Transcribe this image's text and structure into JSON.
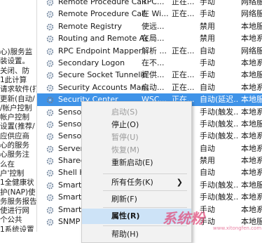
{
  "description_pane": [
    "心)服务监",
    "装设置。",
    "关闭、防",
    "1此计算",
    "请求软件(打",
    "更新(自动/",
    "/帐户控制",
    "帐户控制",
    "设置(推荐/",
    "应供应商",
    "心的服务",
    "心服务注",
    "么在",
    "户'控制",
    "1全健康状",
    "护(NAP)使",
    "务服务报告",
    "使进行网",
    "个公共",
    "1系统设置"
  ],
  "services": [
    {
      "name": "Remote Procedure Call ...",
      "desc": "RPC...",
      "state": "正在...",
      "startup": "手动",
      "logon": "网络服"
    },
    {
      "name": "Remote Procedure Call (...",
      "desc": "在 Wi...",
      "state": "正在...",
      "startup": "手动",
      "logon": "网络服"
    },
    {
      "name": "Remote Registry",
      "desc": "使远...",
      "state": "",
      "startup": "禁用",
      "logon": "本地服"
    },
    {
      "name": "Routing and Remote Acc...",
      "desc": "在局...",
      "state": "",
      "startup": "禁用",
      "logon": "本地系"
    },
    {
      "name": "RPC Endpoint Mapper",
      "desc": "解析 ...",
      "state": "正在...",
      "startup": "自动",
      "logon": "网络服"
    },
    {
      "name": "Secondary Logon",
      "desc": "在不...",
      "state": "",
      "startup": "手动",
      "logon": "本地系"
    },
    {
      "name": "Secure Socket Tunneling ...",
      "desc": "提供...",
      "state": "正在...",
      "startup": "手动",
      "logon": "本地服"
    },
    {
      "name": "Security Accounts Manag...",
      "desc": "启动...",
      "state": "正在...",
      "startup": "自动",
      "logon": "本地系"
    },
    {
      "name": "Security Center",
      "desc": "WSC...",
      "state": "正在...",
      "startup": "自动(延迟...",
      "logon": "本地服"
    },
    {
      "name": "Sensor Data",
      "desc": "",
      "state": "",
      "startup": "手动(触发...",
      "logon": "本地系"
    },
    {
      "name": "Sensor Moni",
      "desc": "",
      "state": "",
      "startup": "手动(触发...",
      "logon": "本地服"
    },
    {
      "name": "Sensor Servi",
      "desc": "",
      "state": "",
      "startup": "手动(触发...",
      "logon": "本地系"
    },
    {
      "name": "Server",
      "desc": "",
      "state": "",
      "startup": "自动",
      "logon": "本地系"
    },
    {
      "name": "Shared PC Ac",
      "desc": "",
      "state": "",
      "startup": "禁用",
      "logon": "本地系"
    },
    {
      "name": "Shell Hardwa",
      "desc": "",
      "state": "",
      "startup": "自动",
      "logon": "本地系"
    },
    {
      "name": "Smart Card",
      "desc": "",
      "state": "",
      "startup": "手动(触发...",
      "logon": "本地服"
    },
    {
      "name": "Smart Card D",
      "desc": "",
      "state": "",
      "startup": "手动(触发...",
      "logon": "本地系"
    },
    {
      "name": "Smart Card R",
      "desc": "",
      "state": "",
      "startup": "手动",
      "logon": "本地系"
    },
    {
      "name": "SNMP 陷阱",
      "desc": "",
      "state": "",
      "startup": "手动",
      "logon": "本地服"
    }
  ],
  "context_menu": {
    "start": "启动(S)",
    "stop": "停止(O)",
    "pause": "暂停(U)",
    "resume": "恢复(M)",
    "restart": "重新启动(E)",
    "all_tasks": "所有任务(K)",
    "refresh": "刷新(F)",
    "properties": "属性(R)",
    "help": "帮助(H)"
  },
  "watermark": {
    "text": "系统粉",
    "url": "www.xitongfen.com"
  },
  "colors": {
    "selection": "#3f93e8",
    "menu_bg": "#f2f2f2",
    "menu_highlight": "#cde3f7",
    "disabled": "#9a9a9a"
  }
}
